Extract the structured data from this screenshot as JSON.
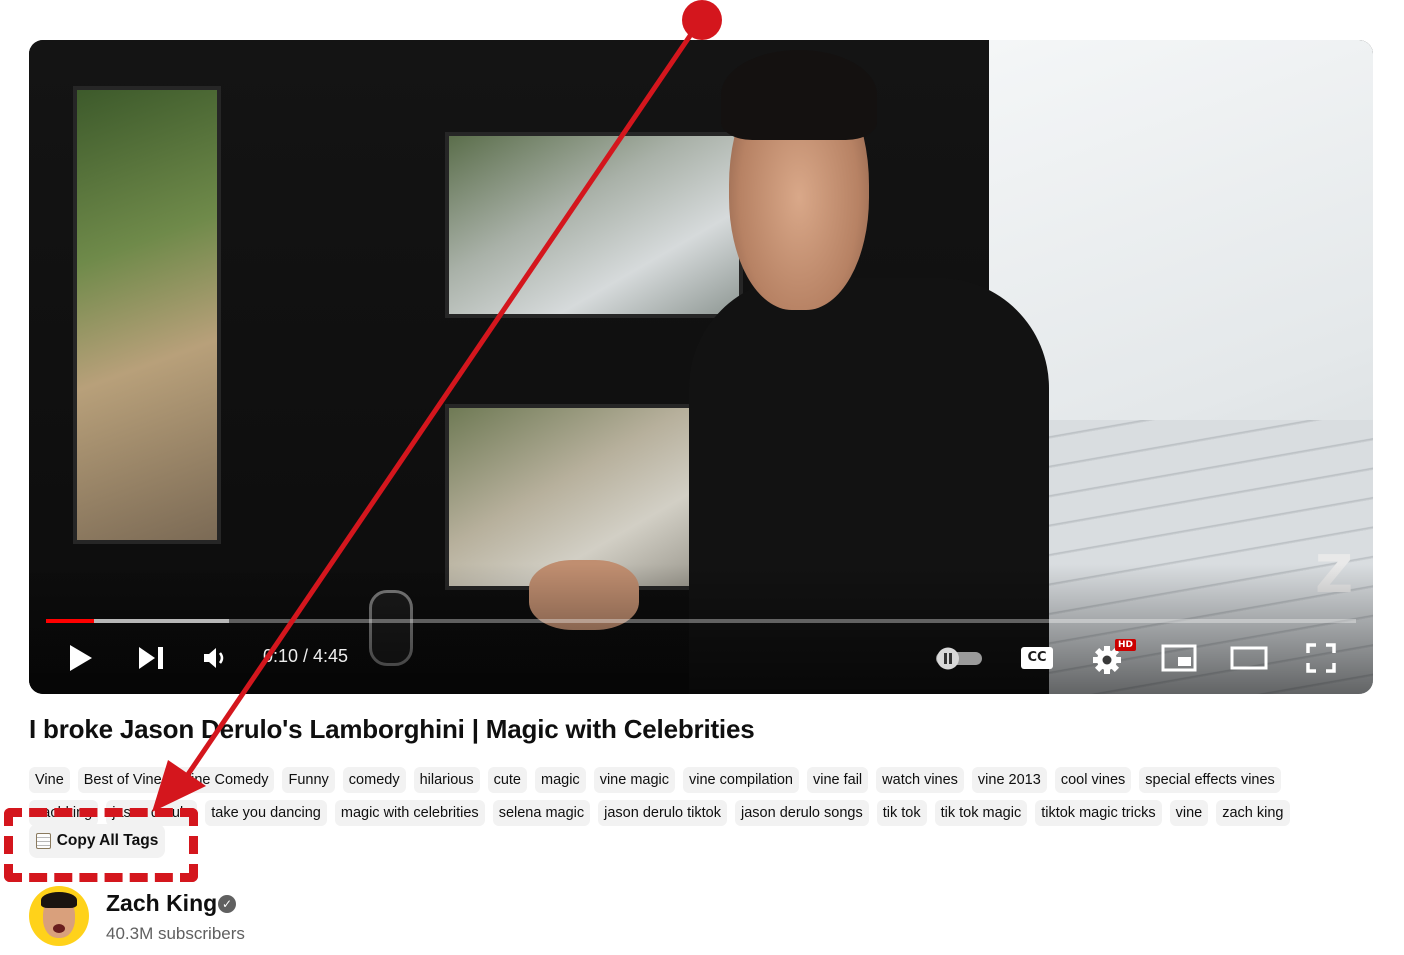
{
  "video": {
    "time_display": "0:10 / 4:45",
    "current_time": "0:10",
    "duration": "4:45",
    "progress_fraction": 0.037,
    "buffered_fraction": 0.14,
    "watermark": "Z",
    "hd_badge": "HD",
    "cc_label": "CC",
    "controls": {
      "play": "play-icon",
      "next": "skip-next-icon",
      "volume": "volume-icon",
      "autoplay": "autoplay-toggle-icon",
      "captions": "captions-icon",
      "settings": "gear-icon",
      "miniplayer": "miniplayer-icon",
      "theater": "theater-mode-icon",
      "fullscreen": "fullscreen-icon"
    },
    "accent_color": "#ff0000"
  },
  "title": "I broke Jason Derulo's Lamborghini | Magic with Celebrities",
  "tags": [
    "Vine",
    "Best of Vine",
    "Vine Comedy",
    "Funny",
    "comedy",
    "hilarious",
    "cute",
    "magic",
    "vine magic",
    "vine compilation",
    "vine fail",
    "watch vines",
    "vine 2013",
    "cool vines",
    "special effects vines",
    "zachking",
    "jason derulo",
    "take you dancing",
    "magic with celebrities",
    "selena magic",
    "jason derulo tiktok",
    "jason derulo songs",
    "tik tok",
    "tik tok magic",
    "tiktok magic tricks",
    "vine",
    "zach king"
  ],
  "copy_button": {
    "label": "Copy All Tags",
    "icon": "clipboard-icon"
  },
  "channel": {
    "name": "Zach King",
    "subscribers": "40.3M subscribers",
    "verified_icon": "verified-check-icon"
  },
  "annotation": {
    "color": "#d4161d",
    "pointer_icon": "arrow-pointer"
  }
}
